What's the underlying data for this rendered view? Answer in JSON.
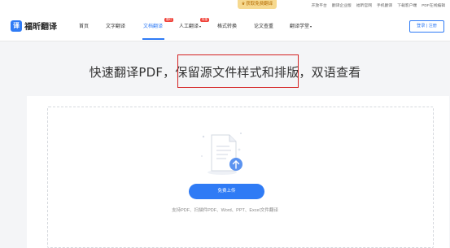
{
  "topbar": {
    "promo": "获取免费翻译",
    "links": [
      "开放平台",
      "翻译企业版",
      "福昕官网",
      "手机翻译",
      "下载客户端",
      "PDF在线编辑"
    ]
  },
  "navbar": {
    "logo_text": "福昕翻译",
    "logo_glyph": "译",
    "items": [
      {
        "label": "首页"
      },
      {
        "label": "文字翻译"
      },
      {
        "label": "文档翻译",
        "badge": "限时"
      },
      {
        "label": "人工翻译",
        "badge": "特惠"
      },
      {
        "label": "格式转换"
      },
      {
        "label": "论文查重"
      },
      {
        "label": "翻译学堂"
      }
    ],
    "login": "登录 | 注册"
  },
  "hero": {
    "part1": "快速翻译PDF，",
    "part2": "保留源文件样式和排版",
    "part3": "，双语查看"
  },
  "upload": {
    "button": "免费上传",
    "support": "支持PDF、扫描件PDF、Word、PPT、Excel文件翻译"
  },
  "colors": {
    "accent": "#2f7bf5",
    "highlight_box": "#d42121",
    "promo_bg": "#f6d98f"
  }
}
